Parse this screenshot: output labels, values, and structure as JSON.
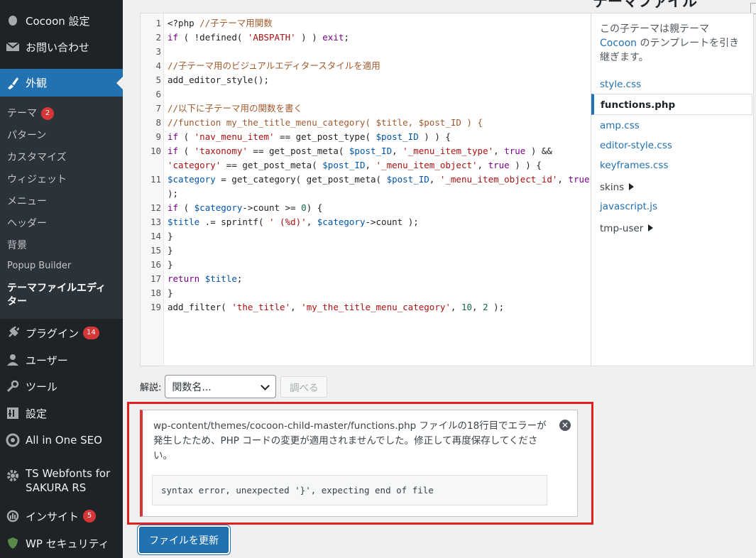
{
  "sidebar": {
    "menu": [
      {
        "label": "Cocoon 設定",
        "icon": "cocoon-icon"
      },
      {
        "label": "お問い合わせ",
        "icon": "mail-icon"
      },
      {
        "label": "外観",
        "icon": "brush-icon"
      },
      {
        "label": "プラグイン",
        "icon": "plugin-icon",
        "badge": "14"
      },
      {
        "label": "ユーザー",
        "icon": "user-icon"
      },
      {
        "label": "ツール",
        "icon": "wrench-icon"
      },
      {
        "label": "設定",
        "icon": "settings-icon"
      },
      {
        "label": "All in One SEO",
        "icon": "seo-icon"
      },
      {
        "label": "TS Webfonts for SAKURA RS",
        "icon": "gear-icon"
      },
      {
        "label": "インサイト",
        "icon": "insight-icon",
        "badge": "5"
      },
      {
        "label": "WP セキュリティ",
        "icon": "shield-icon"
      }
    ],
    "submenu": [
      {
        "label": "テーマ",
        "badge": "2"
      },
      {
        "label": "パターン"
      },
      {
        "label": "カスタマイズ"
      },
      {
        "label": "ウィジェット"
      },
      {
        "label": "メニュー"
      },
      {
        "label": "ヘッダー"
      },
      {
        "label": "背景"
      },
      {
        "label": "Popup Builder"
      },
      {
        "label": "テーマファイルエディター"
      }
    ]
  },
  "editor": {
    "lines": [
      {
        "num": "1",
        "text": "<?php //子テーマ用関数"
      },
      {
        "num": "2",
        "text": "if ( !defined( 'ABSPATH' ) ) exit;"
      },
      {
        "num": "3",
        "text": ""
      },
      {
        "num": "4",
        "text": "//子テーマ用のビジュアルエディタースタイルを適用"
      },
      {
        "num": "5",
        "text": "add_editor_style();"
      },
      {
        "num": "6",
        "text": ""
      },
      {
        "num": "7",
        "text": "//以下に子テーマ用の関数を書く"
      },
      {
        "num": "8",
        "text": "//function my_the_title_menu_category( $title, $post_ID ) {"
      },
      {
        "num": "9",
        "text": "if ( 'nav_menu_item' == get_post_type( $post_ID ) ) {"
      },
      {
        "num": "10",
        "text": "if ( 'taxonomy' == get_post_meta( $post_ID, '_menu_item_type', true ) &&"
      },
      {
        "num": "",
        "text": "'category' == get_post_meta( $post_ID, '_menu_item_object', true ) ) {"
      },
      {
        "num": "11",
        "text": "$category = get_category( get_post_meta( $post_ID, '_menu_item_object_id', true )"
      },
      {
        "num": "",
        "text": ");"
      },
      {
        "num": "12",
        "text": "if ( $category->count >= 0) {"
      },
      {
        "num": "13",
        "text": "$title .= sprintf( ' (%d)', $category->count );"
      },
      {
        "num": "14",
        "text": "}"
      },
      {
        "num": "15",
        "text": "}"
      },
      {
        "num": "16",
        "text": "}"
      },
      {
        "num": "17",
        "text": "return $title;"
      },
      {
        "num": "18",
        "text": "}"
      },
      {
        "num": "19",
        "text": "add_filter( 'the_title', 'my_the_title_menu_category', 10, 2 );"
      }
    ]
  },
  "file_panel": {
    "title": "テーマファイル",
    "notice_prefix": "この子テーマは親テーマ",
    "notice_link": "Cocoon",
    "notice_suffix": "のテンプレートを引き継ぎます。",
    "files": [
      {
        "label": "style.css"
      },
      {
        "label": "functions.php",
        "current": true
      },
      {
        "label": "amp.css"
      },
      {
        "label": "editor-style.css"
      },
      {
        "label": "keyframes.css"
      },
      {
        "label": "skins",
        "folder": true
      },
      {
        "label": "javascript.js"
      },
      {
        "label": "tmp-user",
        "folder": true
      }
    ]
  },
  "docs": {
    "label": "解説:",
    "select_value": "関数名...",
    "lookup_label": "調べる"
  },
  "notice": {
    "message": "wp-content/themes/cocoon-child-master/functions.php ファイルの18行目でエラーが発生したため、PHP コードの変更が適用されませんでした。修正して再度保存してください。",
    "detail": "syntax error, unexpected '}', expecting end of file",
    "dismiss": "✕"
  },
  "update_button": "ファイルを更新"
}
